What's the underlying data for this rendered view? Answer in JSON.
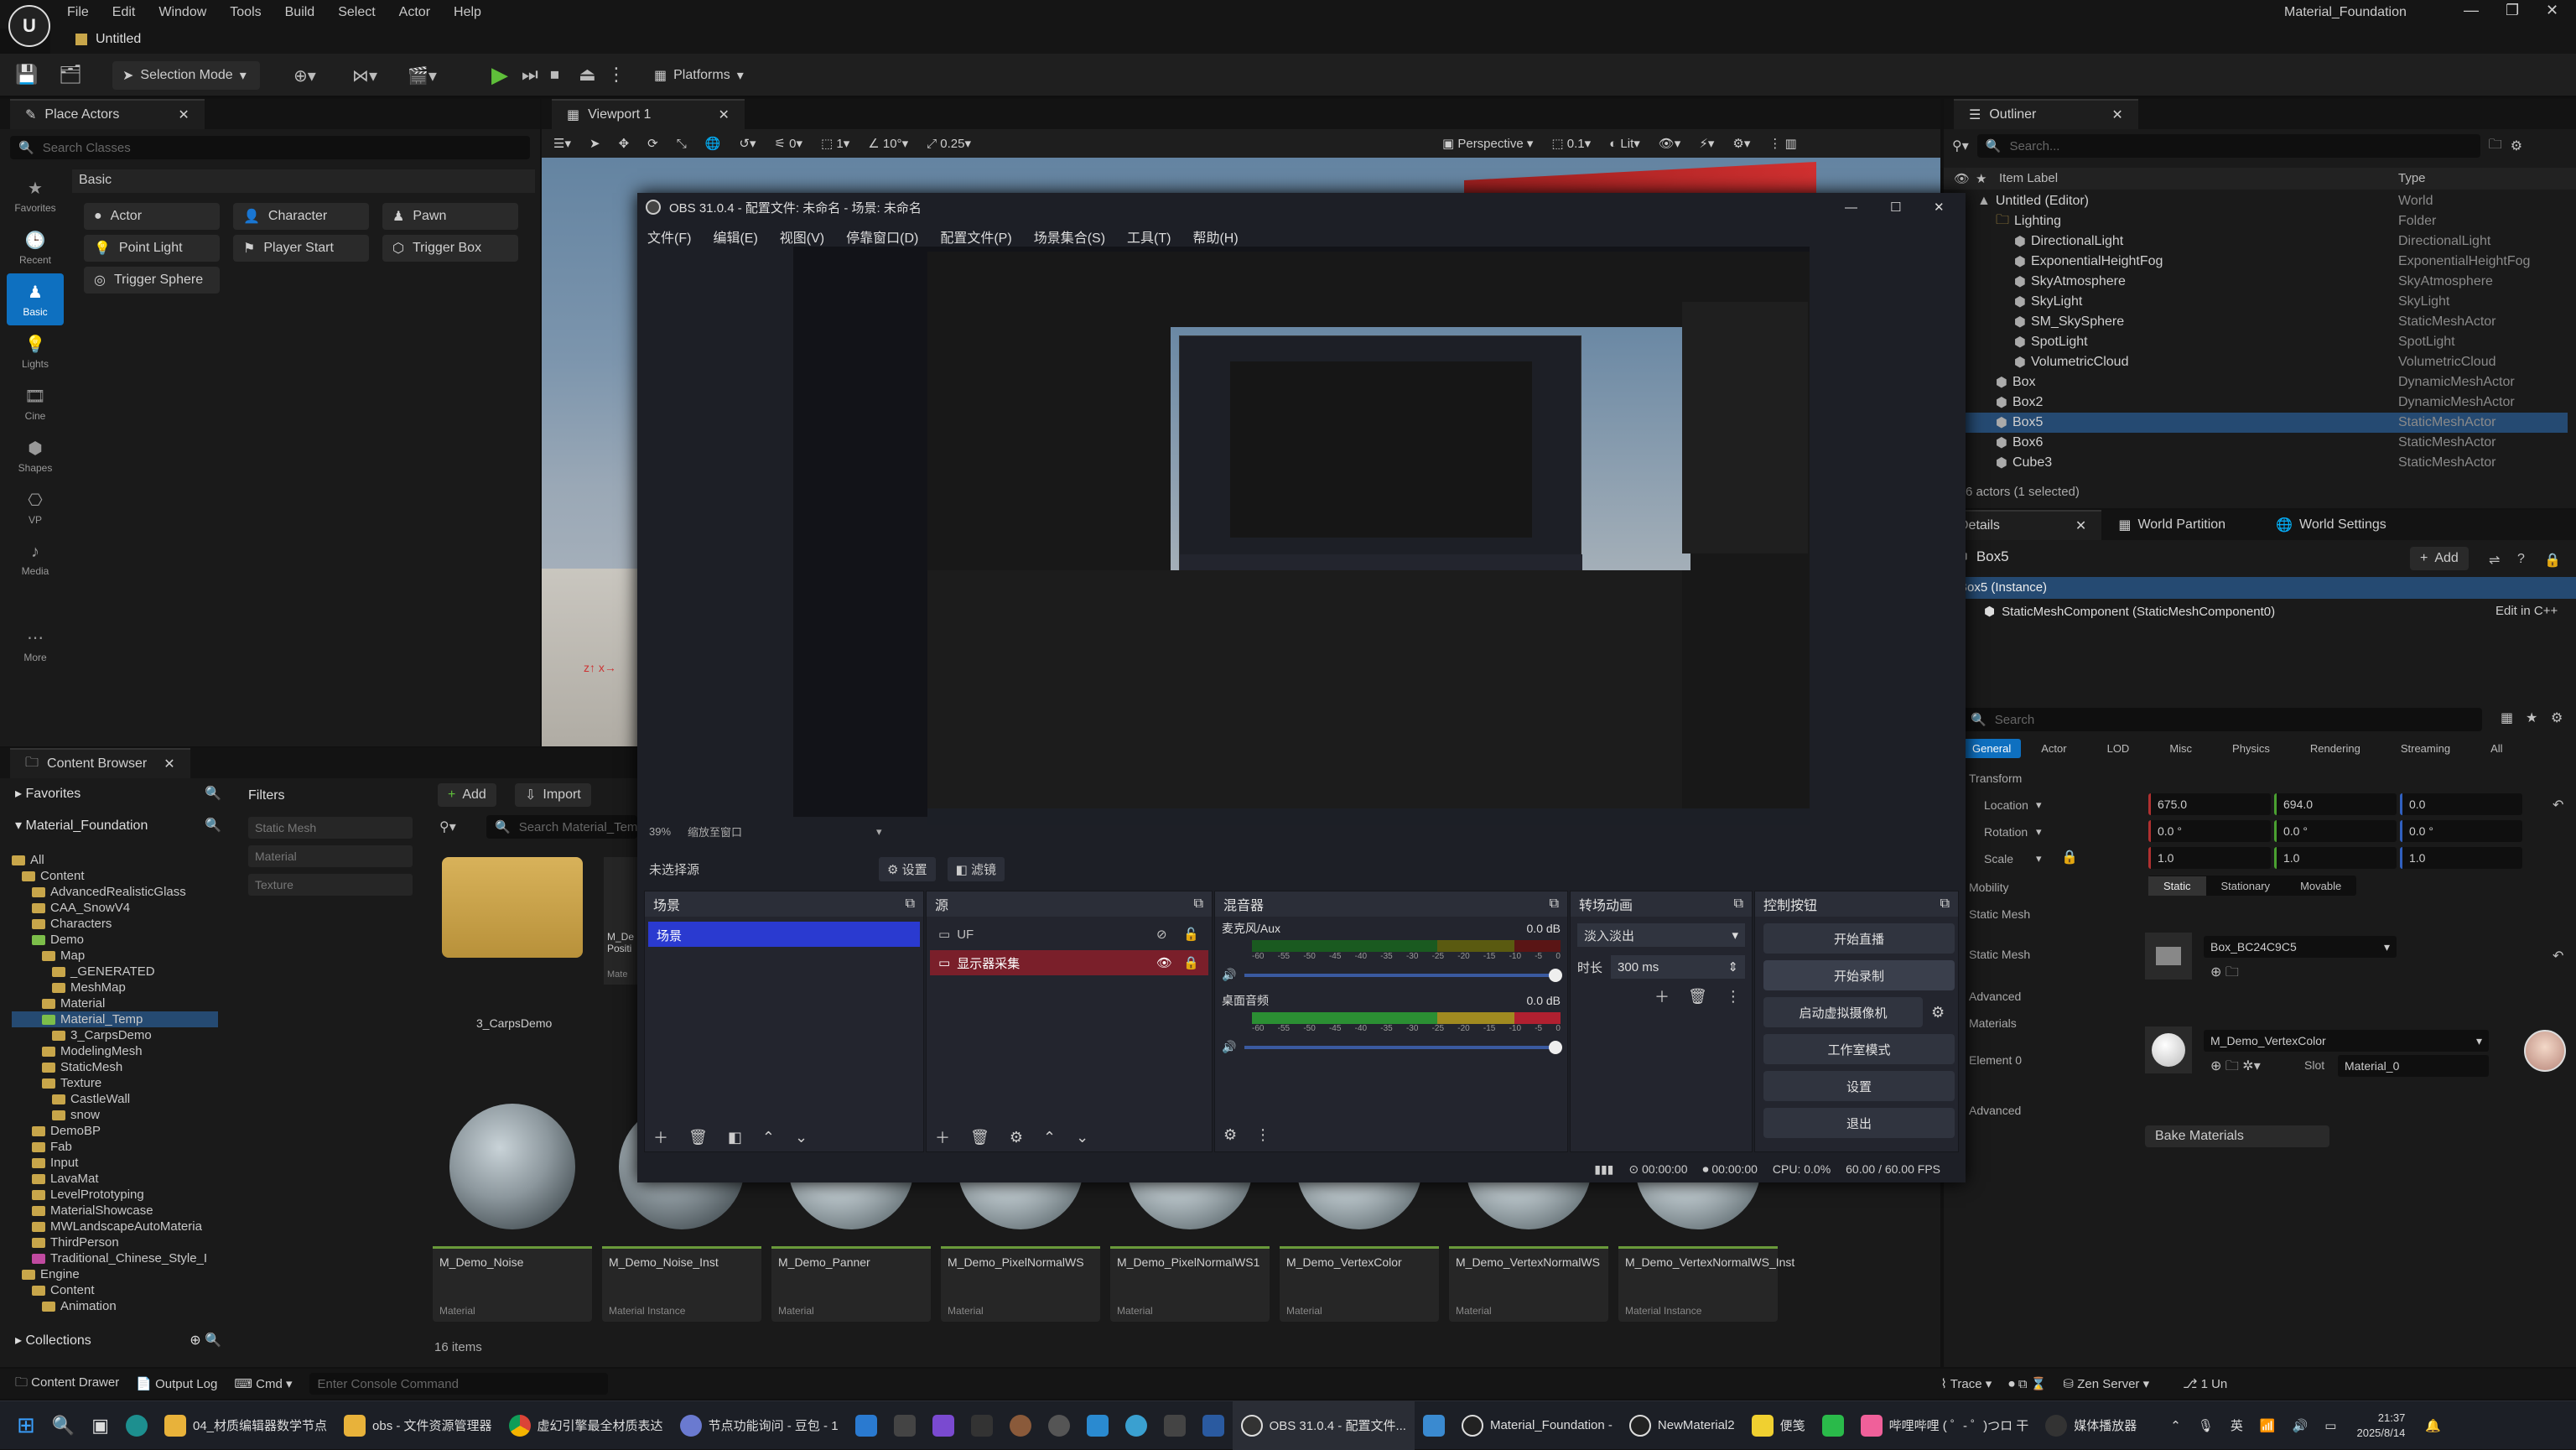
{
  "app": {
    "menu": [
      "File",
      "Edit",
      "Window",
      "Tools",
      "Build",
      "Select",
      "Actor",
      "Help"
    ],
    "project_tab": "Untitled",
    "project_name": "Material_Foundation"
  },
  "toolbar": {
    "selection_mode": "Selection Mode",
    "platforms": "Platforms"
  },
  "place_actors": {
    "tab": "Place Actors",
    "search_placeholder": "Search Classes",
    "section": "Basic",
    "rail": [
      "Favorites",
      "Recent",
      "Basic",
      "Lights",
      "Cine",
      "VP",
      "Shapes",
      "Media",
      "More"
    ],
    "actors": [
      "Actor",
      "Character",
      "Pawn",
      "Point Light",
      "Player Start",
      "Trigger Box",
      "Trigger Sphere"
    ]
  },
  "viewport": {
    "tab": "Viewport 1",
    "perspective": "Perspective",
    "lit": "Lit",
    "snap_move": "10",
    "snap_rot": "10°",
    "snap_scale": "0.25",
    "speed": "0.1",
    "grid": "0",
    "cam": "1"
  },
  "outliner": {
    "tab": "Outliner",
    "search_placeholder": "Search...",
    "col_label": "Item Label",
    "col_type": "Type",
    "rows": [
      {
        "label": "Untitled (Editor)",
        "type": "World"
      },
      {
        "label": "Lighting",
        "type": "Folder"
      },
      {
        "label": "DirectionalLight",
        "type": "DirectionalLight"
      },
      {
        "label": "ExponentialHeightFog",
        "type": "ExponentialHeightFog"
      },
      {
        "label": "SkyAtmosphere",
        "type": "SkyAtmosphere"
      },
      {
        "label": "SkyLight",
        "type": "SkyLight"
      },
      {
        "label": "SM_SkySphere",
        "type": "StaticMeshActor"
      },
      {
        "label": "SpotLight",
        "type": "SpotLight"
      },
      {
        "label": "VolumetricCloud",
        "type": "VolumetricCloud"
      },
      {
        "label": "Box",
        "type": "DynamicMeshActor"
      },
      {
        "label": "Box2",
        "type": "DynamicMeshActor"
      },
      {
        "label": "Box5",
        "type": "StaticMeshActor"
      },
      {
        "label": "Box6",
        "type": "StaticMeshActor"
      },
      {
        "label": "Cube3",
        "type": "StaticMeshActor"
      }
    ],
    "status": "6 actors (1 selected)"
  },
  "details": {
    "tabs": [
      "Details",
      "World Partition",
      "World Settings"
    ],
    "actor": "Box5",
    "add": "Add",
    "instance": "Box5 (Instance)",
    "component": "StaticMeshComponent (StaticMeshComponent0)",
    "edit_cpp": "Edit in C++",
    "search_placeholder": "Search",
    "filters": [
      "General",
      "Actor",
      "LOD",
      "Misc",
      "Physics",
      "Rendering",
      "Streaming",
      "All"
    ],
    "transform": "Transform",
    "location_label": "Location",
    "location": [
      "675.0",
      "694.0",
      "0.0"
    ],
    "rotation_label": "Rotation",
    "rotation": [
      "0.0 °",
      "0.0 °",
      "0.0 °"
    ],
    "scale_label": "Scale",
    "scale": [
      "1.0",
      "1.0",
      "1.0"
    ],
    "mobility_label": "Mobility",
    "mobility": [
      "Static",
      "Stationary",
      "Movable"
    ],
    "static_mesh_section": "Static Mesh",
    "static_mesh_label": "Static Mesh",
    "static_mesh_value": "Box_BC24C9C5",
    "advanced": "Advanced",
    "materials": "Materials",
    "element0": "Element 0",
    "material_value": "M_Demo_VertexColor",
    "slot_label": "Slot",
    "slot_value": "Material_0",
    "bake": "Bake Materials"
  },
  "content_browser": {
    "tab": "Content Browser",
    "favorites": "Favorites",
    "root": "Material_Foundation",
    "filters": "Filters",
    "add": "Add",
    "import": "Import",
    "search_placeholder": "Search Material_Temp",
    "filter_items": [
      "Static Mesh",
      "Material",
      "Texture"
    ],
    "tree": [
      "All",
      "Content",
      "AdvancedRealisticGlass",
      "CAA_SnowV4",
      "Characters",
      "Demo",
      "Map",
      "_GENERATED",
      "MeshMap",
      "Material",
      "Material_Temp",
      "3_CarpsDemo",
      "ModelingMesh",
      "StaticMesh",
      "Texture",
      "CastleWall",
      "snow",
      "DemoBP",
      "Fab",
      "Input",
      "LavaMat",
      "LevelPrototyping",
      "MaterialShowcase",
      "MWLandscapeAutoMateria",
      "ThirdPerson",
      "Traditional_Chinese_Style_I",
      "Engine",
      "Content",
      "Animation"
    ],
    "collections": "Collections",
    "items_count": "16 items",
    "assets_top": [
      {
        "name": "3_CarpsDemo",
        "type": ""
      },
      {
        "name": "M_De Positi",
        "type": "Mate"
      }
    ],
    "assets": [
      {
        "name": "M_Demo_Noise",
        "type": "Material"
      },
      {
        "name": "M_Demo_Noise_Inst",
        "type": "Material Instance"
      },
      {
        "name": "M_Demo_Panner",
        "type": "Material"
      },
      {
        "name": "M_Demo_PixelNormalWS",
        "type": "Material"
      },
      {
        "name": "M_Demo_PixelNormalWS1",
        "type": "Material"
      },
      {
        "name": "M_Demo_VertexColor",
        "type": "Material"
      },
      {
        "name": "M_Demo_VertexNormalWS",
        "type": "Material"
      },
      {
        "name": "M_Demo_VertexNormalWS_Inst",
        "type": "Material Instance"
      }
    ]
  },
  "bottom_bar": {
    "drawer": "Content Drawer",
    "log": "Output Log",
    "cmd": "Cmd",
    "console_placeholder": "Enter Console Command",
    "trace": "Trace",
    "zen": "Zen Server",
    "uncontrolled": "1 Un"
  },
  "obs": {
    "title": "OBS 31.0.4 - 配置文件: 未命名 - 场景: 未命名",
    "menu": [
      "文件(F)",
      "编辑(E)",
      "视图(V)",
      "停靠窗口(D)",
      "配置文件(P)",
      "场景集合(S)",
      "工具(T)",
      "帮助(H)"
    ],
    "zoom": "39%",
    "preview_mode": "缩放至窗口",
    "no_source": "未选择源",
    "props": "设置",
    "filters": "滤镜",
    "scenes_title": "场景",
    "scene": "场景",
    "sources_title": "源",
    "sources": [
      "UF",
      "显示器采集"
    ],
    "mixer_title": "混音器",
    "mic": "麦克风/Aux",
    "mic_db": "0.0 dB",
    "desktop": "桌面音频",
    "desktop_db": "0.0 dB",
    "scale": [
      "-60",
      "-55",
      "-50",
      "-45",
      "-40",
      "-35",
      "-30",
      "-25",
      "-20",
      "-15",
      "-10",
      "-5",
      "0"
    ],
    "transition_title": "转场动画",
    "transition": "淡入淡出",
    "duration_label": "时长",
    "duration": "300 ms",
    "controls_title": "控制按钮",
    "controls": [
      "开始直播",
      "开始录制",
      "启动虚拟摄像机",
      "工作室模式",
      "设置",
      "退出"
    ],
    "stream_time": "00:00:00",
    "rec_time": "00:00:00",
    "cpu": "CPU: 0.0%",
    "fps": "60.00 / 60.00 FPS"
  },
  "taskbar": {
    "items": [
      "04_材质编辑器数学节点",
      "obs - 文件资源管理器",
      "虚幻引擎最全材质表达",
      "节点功能询问 - 豆包 - 1",
      "OBS 31.0.4 - 配置文件...",
      "Material_Foundation -",
      "NewMaterial2",
      "便笺",
      "哔哩哔哩 ( ゜- ゜)つロ 干",
      "媒体播放器"
    ],
    "time": "21:37",
    "date": "2025/8/14",
    "lang": "英"
  },
  "colors": {
    "ue_bg": "#1a1a1a",
    "accent": "#0e70c0",
    "obs_bg": "#1d1f26",
    "obs_selected": "#2a3ad0",
    "obs_red": "#7a1f2a"
  }
}
